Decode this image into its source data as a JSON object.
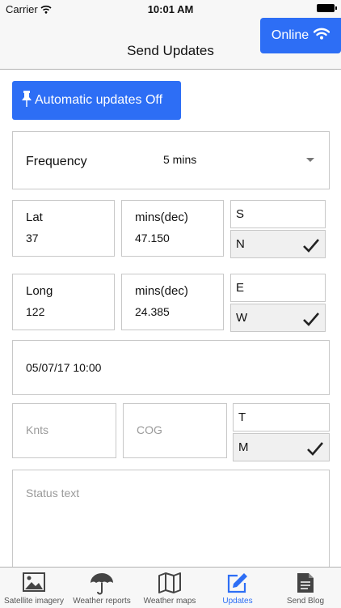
{
  "status_bar": {
    "carrier": "Carrier",
    "time": "10:01 AM"
  },
  "nav": {
    "title": "Send Updates",
    "online_label": "Online"
  },
  "auto_updates": {
    "label": "Automatic updates Off"
  },
  "frequency": {
    "label": "Frequency",
    "value": "5 mins"
  },
  "lat": {
    "deg_label": "Lat",
    "deg_value": "37",
    "min_label": "mins(dec)",
    "min_value": "47.150",
    "hemi_options": [
      "S",
      "N"
    ],
    "hemi_selected": "N"
  },
  "long": {
    "deg_label": "Long",
    "deg_value": "122",
    "min_label": "mins(dec)",
    "min_value": "24.385",
    "hemi_options": [
      "E",
      "W"
    ],
    "hemi_selected": "W"
  },
  "datetime": {
    "value": "05/07/17 10:00"
  },
  "speed": {
    "placeholder": "Knts"
  },
  "course": {
    "placeholder": "COG",
    "ref_options": [
      "T",
      "M"
    ],
    "ref_selected": "M"
  },
  "status_text": {
    "placeholder": "Status text"
  },
  "tabs": [
    {
      "label": "Satellite imagery",
      "icon": "image-icon"
    },
    {
      "label": "Weather reports",
      "icon": "umbrella-icon"
    },
    {
      "label": "Weather maps",
      "icon": "map-icon"
    },
    {
      "label": "Updates",
      "icon": "edit-icon",
      "active": true
    },
    {
      "label": "Send Blog",
      "icon": "document-icon"
    }
  ],
  "colors": {
    "accent": "#2d6ef5",
    "border": "#c8c8c8",
    "selected_bg": "#f0f0f0"
  }
}
